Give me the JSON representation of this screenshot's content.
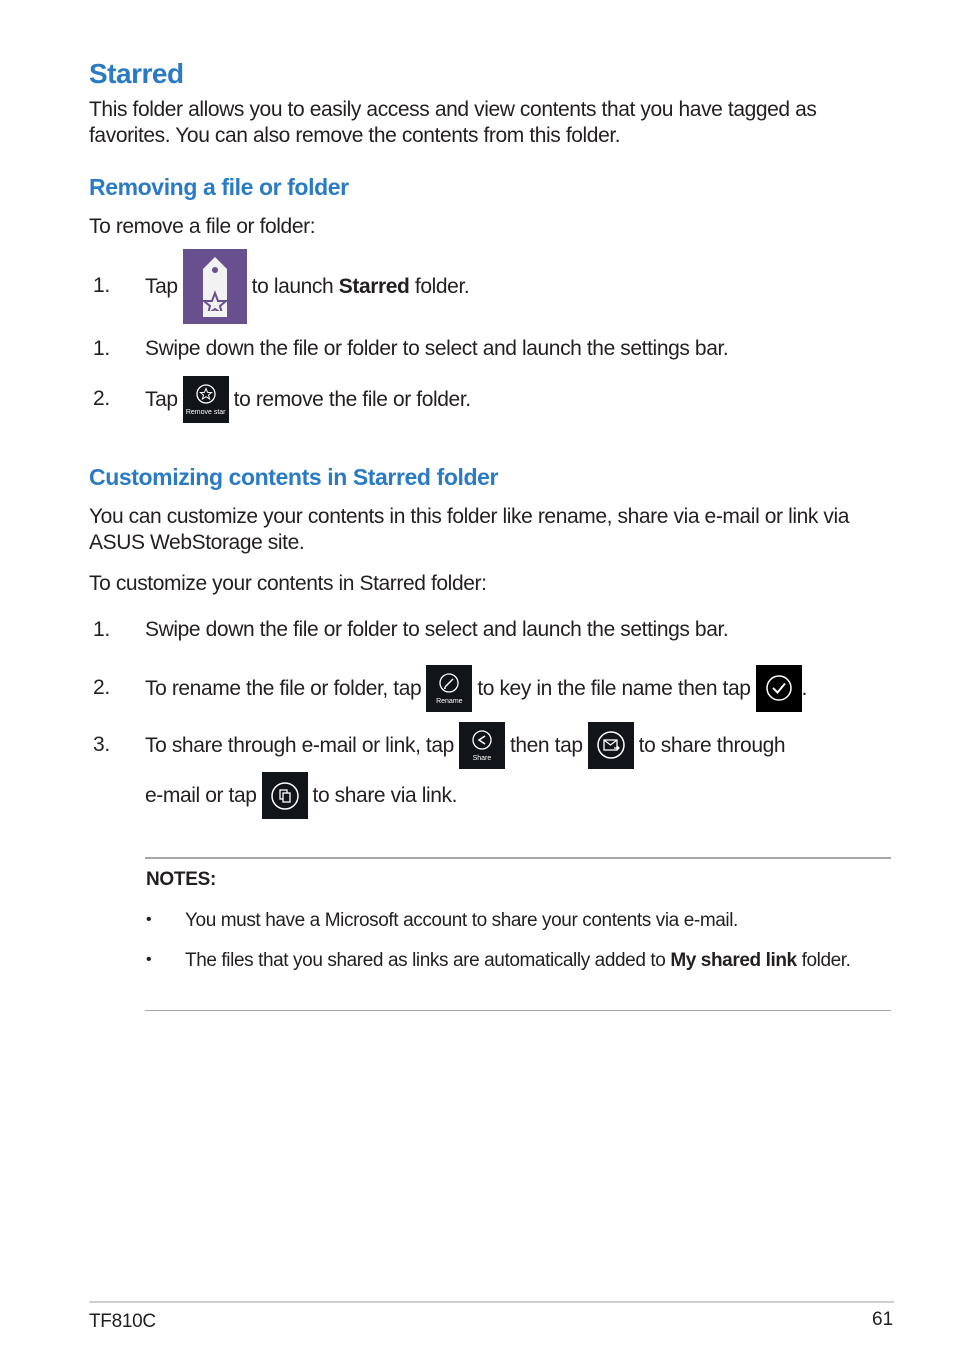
{
  "section_title": "Starred",
  "intro": "This folder allows you to easily access and view contents that you have tagged as favorites. You can also remove the contents from this folder.",
  "removing": {
    "heading": "Removing a file or folder",
    "lead": "To remove a file or folder:",
    "steps": [
      {
        "num": "1.",
        "pre": "Tap",
        "icon": "starred-app-tile-icon",
        "post_a": "to launch ",
        "bold": "Starred",
        "post_b": " folder."
      },
      {
        "num": "1.",
        "text": "Swipe down the file or folder to select and launch the settings bar."
      },
      {
        "num": "2.",
        "pre": "Tap",
        "icon": "remove-star-icon",
        "icon_label": "Remove star",
        "post": "to remove the file or folder."
      }
    ]
  },
  "customizing": {
    "heading": "Customizing contents in Starred folder",
    "intro": "You can customize your contents in this folder like rename, share via e-mail or link via ASUS WebStorage site.",
    "lead": "To customize your contents in Starred folder:",
    "steps": [
      {
        "num": "1.",
        "text": "Swipe down the file or folder to select and launch the settings bar."
      },
      {
        "num": "2.",
        "pre": "To rename the file or folder, tap",
        "icon1_label": "Rename",
        "mid": "to key in the file name then tap",
        "post": "."
      },
      {
        "num": "3.",
        "pre": "To share through e-mail or link, tap",
        "icon1_label": "Share",
        "mid": "then tap",
        "post": "to share through",
        "line2_pre": "e-mail or tap",
        "line2_post": "to share via link."
      }
    ]
  },
  "notes": {
    "title": "NOTES:",
    "bullet": "•",
    "items": [
      {
        "text": "You must have a Microsoft account to share your contents via e-mail."
      },
      {
        "pre": "The files that you shared as links are automatically added to ",
        "bold": "My shared link",
        "post": " folder."
      }
    ]
  },
  "footer": {
    "model": "TF810C",
    "page": "61"
  },
  "colors": {
    "heading_blue": "#2a7bc4",
    "starred_tile_purple": "#68508e",
    "icon_dark": "#111418"
  }
}
